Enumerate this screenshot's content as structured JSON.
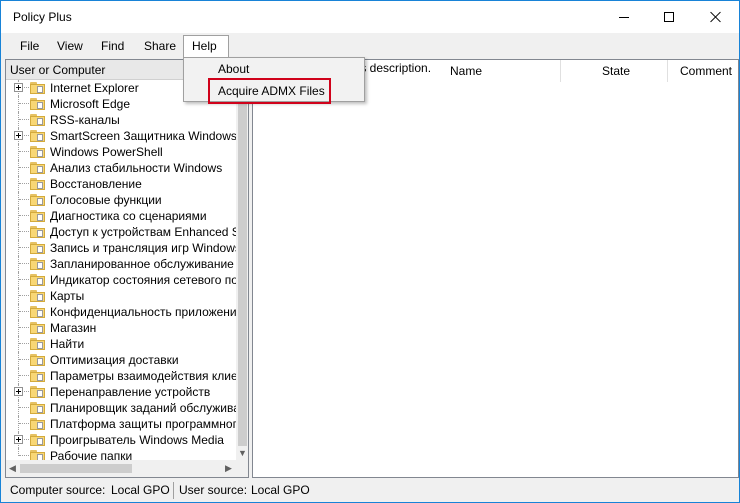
{
  "window": {
    "title": "Policy Plus"
  },
  "menu": {
    "file": "File",
    "view": "View",
    "find": "Find",
    "share": "Share",
    "help": "Help"
  },
  "help_menu": {
    "about": "About",
    "acquire_admx": "Acquire ADMX Files",
    "highlight_color": "#d0021b"
  },
  "tree": {
    "header": "User or Computer",
    "items": [
      {
        "label": "Internet Explorer",
        "expandable": true
      },
      {
        "label": "Microsoft Edge",
        "expandable": false
      },
      {
        "label": "RSS-каналы",
        "expandable": false
      },
      {
        "label": "SmartScreen Защитника Windows",
        "expandable": true
      },
      {
        "label": "Windows PowerShell",
        "expandable": false
      },
      {
        "label": "Анализ стабильности Windows",
        "expandable": false
      },
      {
        "label": "Восстановление",
        "expandable": false
      },
      {
        "label": "Голосовые функции",
        "expandable": false
      },
      {
        "label": "Диагностика со сценариями",
        "expandable": false
      },
      {
        "label": "Доступ к устройствам Enhanced Sto",
        "expandable": false
      },
      {
        "label": "Запись и трансляция игр Windows",
        "expandable": false
      },
      {
        "label": "Запланированное обслуживание",
        "expandable": false
      },
      {
        "label": "Индикатор состояния сетевого подк",
        "expandable": false
      },
      {
        "label": "Карты",
        "expandable": false
      },
      {
        "label": "Конфиденциальность приложения",
        "expandable": false
      },
      {
        "label": "Магазин",
        "expandable": false
      },
      {
        "label": "Найти",
        "expandable": false
      },
      {
        "label": "Оптимизация доставки",
        "expandable": false
      },
      {
        "label": "Параметры взаимодействия клиент",
        "expandable": false
      },
      {
        "label": "Перенаправление устройств",
        "expandable": true
      },
      {
        "label": "Планировщик заданий обслуживания",
        "expandable": false
      },
      {
        "label": "Платформа защиты программного с",
        "expandable": false
      },
      {
        "label": "Проигрыватель Windows Media",
        "expandable": true
      },
      {
        "label": "Рабочие папки",
        "expandable": false
      }
    ]
  },
  "right_pane": {
    "description_fragment": "ts description.",
    "columns": {
      "name": "Name",
      "state": "State",
      "comment": "Comment"
    }
  },
  "status": {
    "computer_source_label": "Computer source:",
    "computer_source_value": "Local GPO",
    "user_source_label": "User source:",
    "user_source_value": "Local GPO"
  },
  "colors": {
    "window_border": "#1883d7",
    "folder": "#f8d775"
  }
}
